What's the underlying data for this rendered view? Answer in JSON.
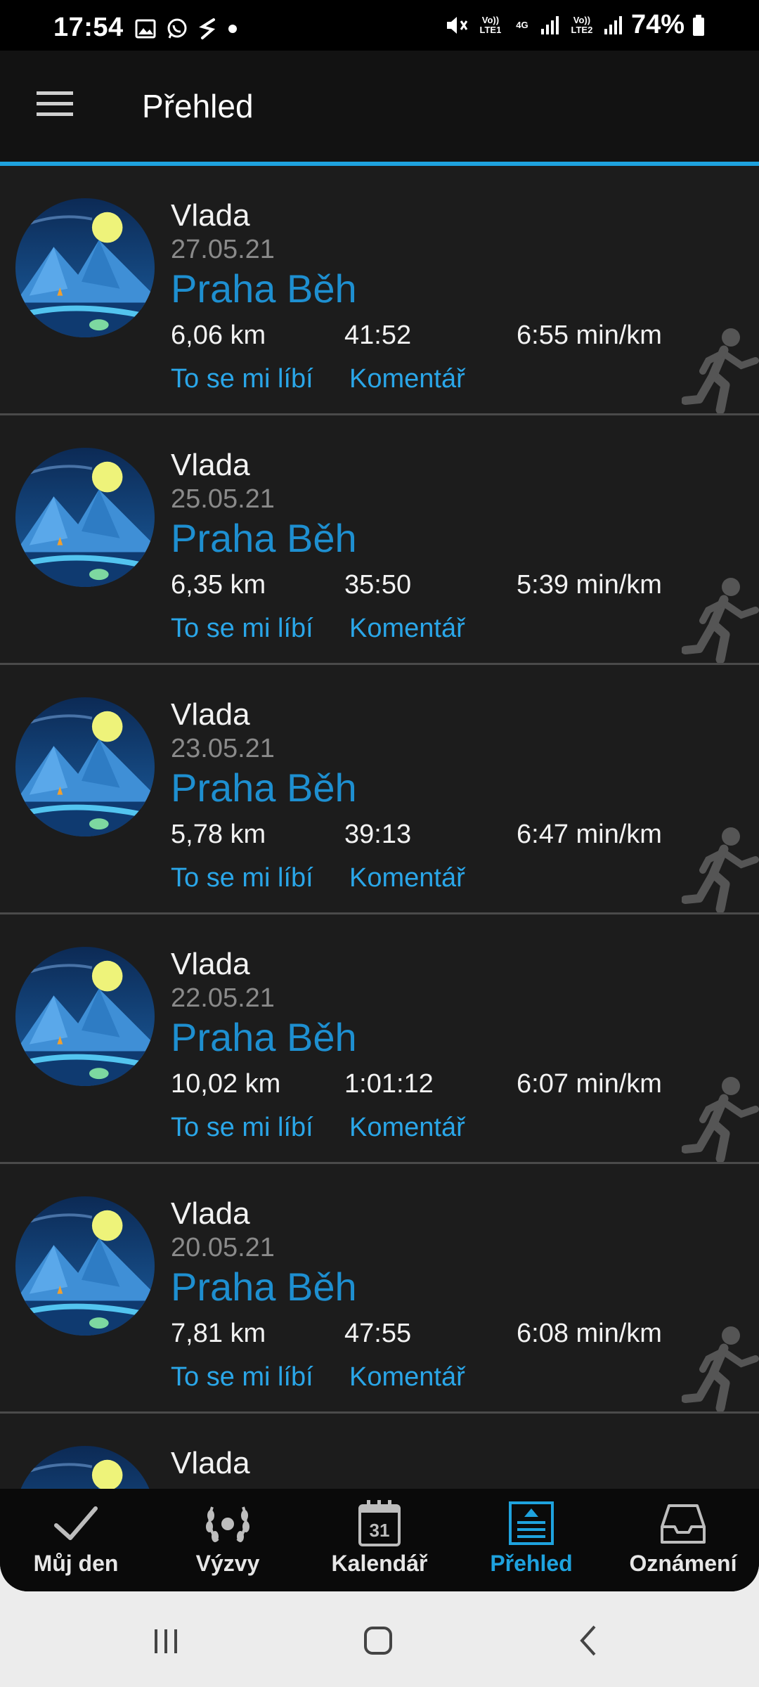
{
  "status_bar": {
    "time": "17:54",
    "battery": "74%",
    "sim1": "Vo)) LTE1",
    "sim2": "Vo)) LTE2",
    "network": "4G"
  },
  "app_bar": {
    "title": "Přehled"
  },
  "feed": [
    {
      "user": "Vlada",
      "date": "27.05.21",
      "title": "Praha Běh",
      "distance": "6,06 km",
      "duration": "41:52",
      "pace": "6:55 min/km",
      "like": "To se mi líbí",
      "comment": "Komentář"
    },
    {
      "user": "Vlada",
      "date": "25.05.21",
      "title": "Praha Běh",
      "distance": "6,35 km",
      "duration": "35:50",
      "pace": "5:39 min/km",
      "like": "To se mi líbí",
      "comment": "Komentář"
    },
    {
      "user": "Vlada",
      "date": "23.05.21",
      "title": "Praha Běh",
      "distance": "5,78 km",
      "duration": "39:13",
      "pace": "6:47 min/km",
      "like": "To se mi líbí",
      "comment": "Komentář"
    },
    {
      "user": "Vlada",
      "date": "22.05.21",
      "title": "Praha Běh",
      "distance": "10,02 km",
      "duration": "1:01:12",
      "pace": "6:07 min/km",
      "like": "To se mi líbí",
      "comment": "Komentář"
    },
    {
      "user": "Vlada",
      "date": "20.05.21",
      "title": "Praha Běh",
      "distance": "7,81 km",
      "duration": "47:55",
      "pace": "6:08 min/km",
      "like": "To se mi líbí",
      "comment": "Komentář"
    },
    {
      "user": "Vlada",
      "date": "",
      "title": "",
      "distance": "",
      "duration": "",
      "pace": "",
      "like": "",
      "comment": ""
    }
  ],
  "bottom_nav": [
    {
      "label": "Můj den",
      "icon": "checkmark-icon",
      "active": false
    },
    {
      "label": "Výzvy",
      "icon": "laurel-wreath-icon",
      "active": false
    },
    {
      "label": "Kalendář",
      "icon": "calendar-icon",
      "calendar_day": "31",
      "active": false
    },
    {
      "label": "Přehled",
      "icon": "newsfeed-icon",
      "active": true
    },
    {
      "label": "Oznámení",
      "icon": "inbox-icon",
      "active": false
    }
  ],
  "colors": {
    "accent": "#1ea2de",
    "title_blue": "#1e8fd0",
    "link_blue": "#2aa6e8",
    "background": "#1c1c1c"
  }
}
